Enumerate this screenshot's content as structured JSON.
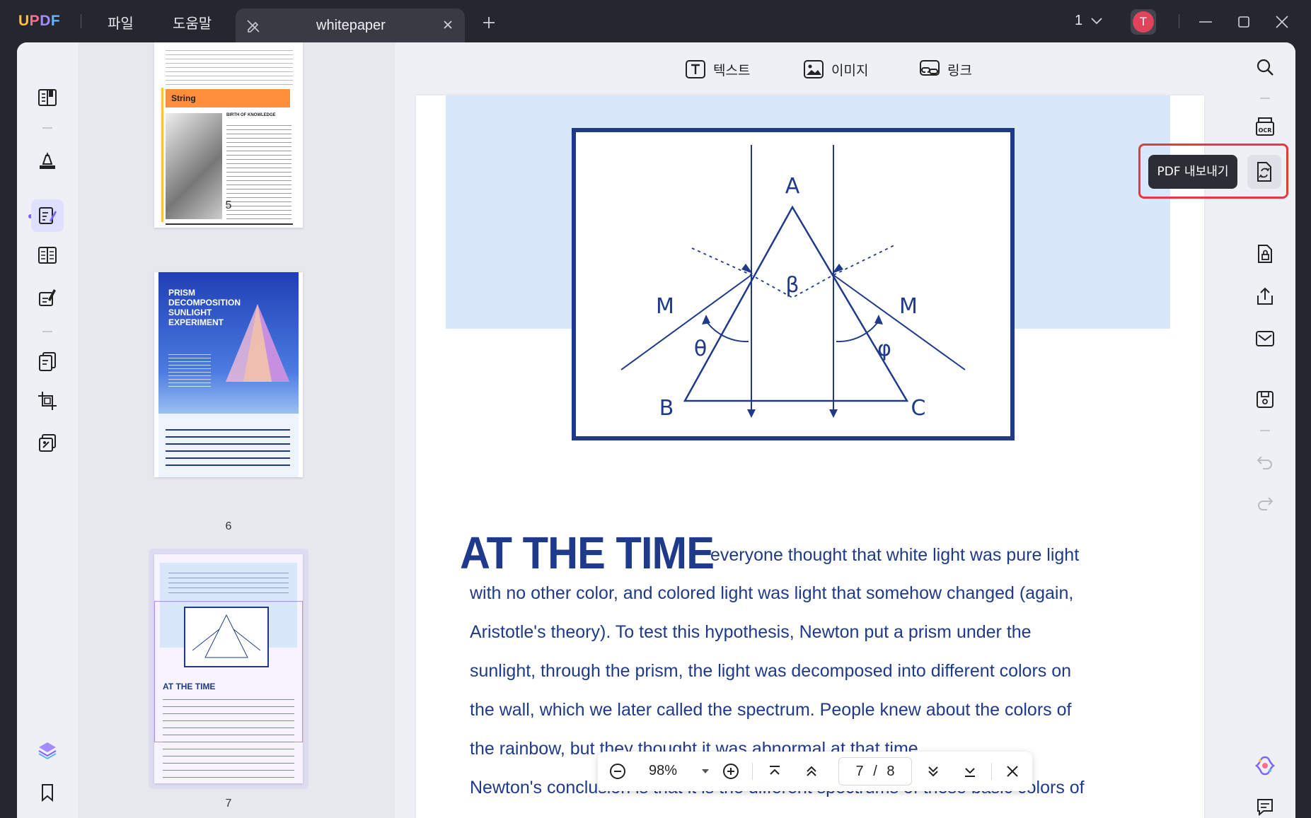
{
  "app": {
    "logo": [
      "U",
      "P",
      "D",
      "F"
    ],
    "menu": {
      "file": "파일",
      "help": "도움말"
    },
    "tab_title": "whitepaper",
    "page_indicator": "1",
    "avatar_letter": "T"
  },
  "left_toolbar": {
    "items": [
      "reader-icon",
      "comment-icon",
      "edit-pdf-icon",
      "organize-icon",
      "fill-sign-icon",
      "pages-icon",
      "crop-icon",
      "watermark-icon",
      "layers-icon",
      "bookmark-icon",
      "attachment-icon"
    ]
  },
  "thumbnails": {
    "page5": {
      "number": "5",
      "section": "String",
      "subheading": "BIRTH OF KNOWLEDGE"
    },
    "page6": {
      "number": "6",
      "title_lines": [
        "PRISM",
        "DECOMPOSITION",
        "SUNLIGHT",
        "EXPERIMENT"
      ]
    },
    "page7": {
      "number": "7",
      "heading": "AT THE TIME"
    }
  },
  "edit_bar": {
    "text": "텍스트",
    "image": "이미지",
    "link": "링크"
  },
  "page_content": {
    "diagram_labels": {
      "a": "A",
      "b": "B",
      "c": "C",
      "m_left": "M",
      "m_right": "M",
      "beta": "β",
      "theta": "θ",
      "phi": "φ"
    },
    "headline": "AT THE TIME",
    "lines": [
      "everyone thought that white light was pure light",
      "with no other color, and colored light was light that somehow changed (again,",
      "Aristotle's theory). To test this hypothesis, Newton put a prism under the",
      "sunlight, through the prism, the light was decomposed into different colors on",
      "the wall, which we later called the spectrum. People knew about the colors of",
      "the rainbow, but they thought it was abnormal at that time.",
      "Newton's conclusion is that it is the different spectrums of these basic colors of"
    ]
  },
  "right_toolbar": {
    "tooltip": "PDF 내보내기",
    "items": [
      "search-icon",
      "ocr-icon",
      "export-pdf-icon",
      "protect-icon",
      "share-icon",
      "email-icon",
      "save-icon",
      "undo-icon",
      "redo-icon",
      "ai-icon",
      "comments-list-icon"
    ]
  },
  "bottom_bar": {
    "zoom": "98%",
    "page_current": "7",
    "page_total": "8",
    "page_separator": "/"
  },
  "colors": {
    "accent": "#7b63ff",
    "doc_blue": "#1f3a8a",
    "highlight_red": "#e23b3b",
    "band": "#d9e7fb"
  }
}
